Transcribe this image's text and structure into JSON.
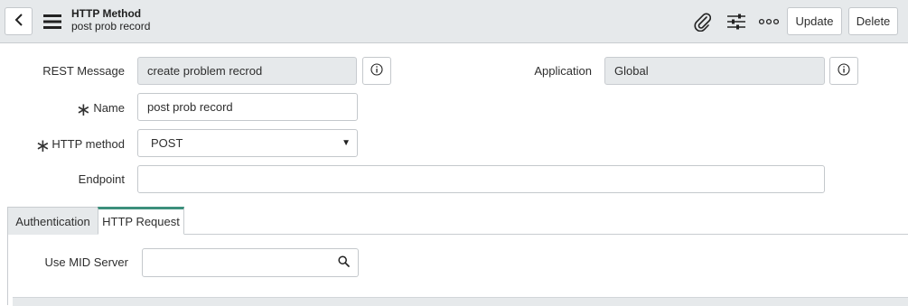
{
  "header": {
    "title": "HTTP Method",
    "subtitle": "post prob record",
    "update_label": "Update",
    "delete_label": "Delete",
    "icons": [
      "chevron-left-icon",
      "hamburger-menu-icon",
      "paperclip-icon",
      "settings-sliders-icon",
      "more-options-icon"
    ]
  },
  "form": {
    "rest_message": {
      "label": "REST Message",
      "value": "create problem recrod"
    },
    "application": {
      "label": "Application",
      "value": "Global"
    },
    "name": {
      "label": "Name",
      "value": "post prob record"
    },
    "http_method": {
      "label": "HTTP method",
      "value": "POST"
    },
    "endpoint": {
      "label": "Endpoint",
      "value": ""
    }
  },
  "tabs": [
    {
      "label": "Authentication",
      "active": false
    },
    {
      "label": "HTTP Request",
      "active": true
    }
  ],
  "http_request": {
    "use_mid_server": {
      "label": "Use MID Server",
      "value": ""
    }
  },
  "colors": {
    "header_bg": "#e6e9eb",
    "readonly_bg": "#e6e9eb",
    "tab_accent": "#3c8f7c"
  }
}
